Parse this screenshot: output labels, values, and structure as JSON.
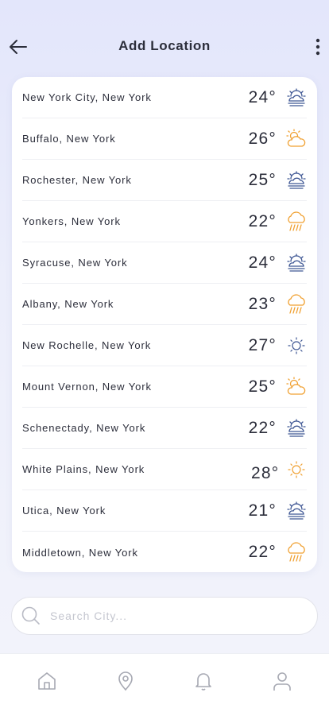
{
  "header": {
    "title": "Add Location"
  },
  "locations": [
    {
      "city": "New York City, New York",
      "temp": "24°",
      "icon": "cloudy-sun-icon",
      "icon_color": "#3f5794"
    },
    {
      "city": "Buffalo, New York",
      "temp": "26°",
      "icon": "partly-sunny-icon",
      "icon_color": "#f0a030"
    },
    {
      "city": "Rochester, New York",
      "temp": "25°",
      "icon": "cloudy-sun-icon",
      "icon_color": "#3f5794"
    },
    {
      "city": "Yonkers, New York",
      "temp": "22°",
      "icon": "rain-icon",
      "icon_color": "#f0a030"
    },
    {
      "city": "Syracuse, New York",
      "temp": "24°",
      "icon": "cloudy-sun-icon",
      "icon_color": "#3f5794"
    },
    {
      "city": "Albany, New York",
      "temp": "23°",
      "icon": "rain-icon",
      "icon_color": "#f0a030"
    },
    {
      "city": "New Rochelle, New York",
      "temp": "27°",
      "icon": "sun-icon",
      "icon_color": "#3f5794"
    },
    {
      "city": "Mount Vernon, New York",
      "temp": "25°",
      "icon": "partly-sunny-icon",
      "icon_color": "#f0a030"
    },
    {
      "city": "Schenectady, New York",
      "temp": "22°",
      "icon": "cloudy-sun-icon",
      "icon_color": "#3f5794"
    },
    {
      "city": "White Plains, New York",
      "temp": "28°",
      "icon": "sun-icon",
      "icon_color": "#f0a030"
    },
    {
      "city": "Utica, New York",
      "temp": "21°",
      "icon": "cloudy-sun-icon",
      "icon_color": "#3f5794"
    },
    {
      "city": "Middletown, New York",
      "temp": "22°",
      "icon": "rain-icon",
      "icon_color": "#f0a030"
    }
  ],
  "search": {
    "placeholder": "Search City..."
  },
  "tabs": [
    {
      "name": "home-tab",
      "icon": "home-icon"
    },
    {
      "name": "location-tab",
      "icon": "location-pin-icon"
    },
    {
      "name": "notifications-tab",
      "icon": "bell-icon"
    },
    {
      "name": "profile-tab",
      "icon": "user-icon"
    }
  ],
  "colors": {
    "accent_blue": "#3f5794",
    "accent_orange": "#f0a030",
    "text": "#2b2d3a",
    "tab_icon": "#a6a8b2"
  }
}
